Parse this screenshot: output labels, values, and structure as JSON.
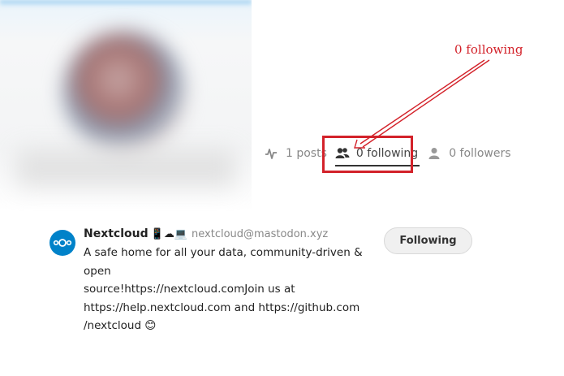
{
  "profile": {
    "stats": {
      "posts": "1 posts",
      "following": "0 following",
      "followers": "0 followers"
    }
  },
  "annotation": {
    "label": "0 following",
    "color": "#d3222a"
  },
  "account": {
    "display_name": "Nextcloud",
    "name_emojis": "📱☁💻",
    "handle": "nextcloud@mastodon.xyz",
    "bio": "A safe home for all your data, community-driven & open\nsource!https://nextcloud.comJoin us at\nhttps://help.nextcloud.com and https://github.com\n/nextcloud 😊",
    "follow_button_label": "Following",
    "avatar_color": "#0082c9",
    "avatar_icon": "nextcloud-logo-icon"
  },
  "icons": {
    "posts": "activity-icon",
    "following": "users-icon",
    "followers": "user-icon"
  }
}
